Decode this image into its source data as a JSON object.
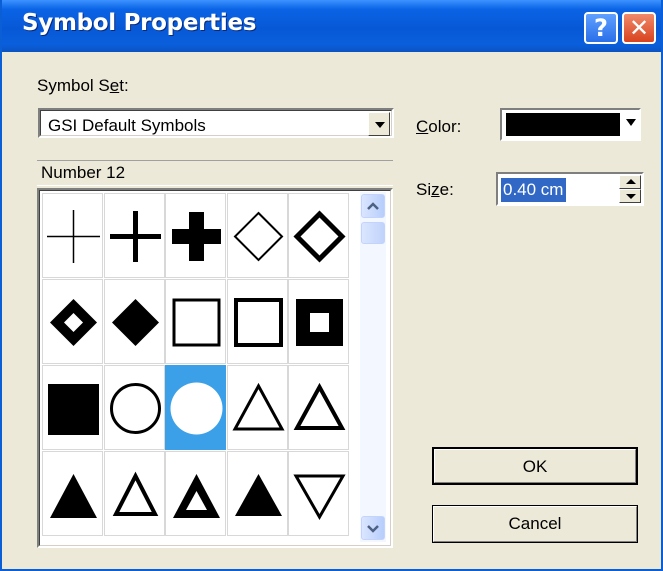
{
  "window": {
    "title": "Symbol Properties",
    "help_glyph": "?",
    "close_glyph": "✕"
  },
  "symbol_set": {
    "label_pre": "Symbol S",
    "label_accel": "e",
    "label_post": "t:",
    "value": "GSI Default Symbols"
  },
  "list": {
    "header": "Number 12",
    "selected_index": 12,
    "symbols": [
      "thin-cross",
      "medium-cross",
      "thick-cross",
      "diamond-outline-thin",
      "diamond-outline-thick",
      "diamond-in-diamond",
      "diamond-filled",
      "square-outline-thin",
      "square-outline-medium",
      "square-in-square",
      "square-filled",
      "circle-outline",
      "circle-filled-selected",
      "triangle-outline-thin",
      "triangle-outline-medium",
      "triangle-filled",
      "triangle-outline-bold",
      "triangle-in-triangle",
      "triangle-filled-2",
      "triangle-down-outline"
    ]
  },
  "color": {
    "label_accel": "C",
    "label_post": "olor:",
    "value": "#000000"
  },
  "size": {
    "label_pre": "Si",
    "label_accel": "z",
    "label_post": "e:",
    "value": "0.40 cm"
  },
  "buttons": {
    "ok": "OK",
    "cancel": "Cancel"
  }
}
